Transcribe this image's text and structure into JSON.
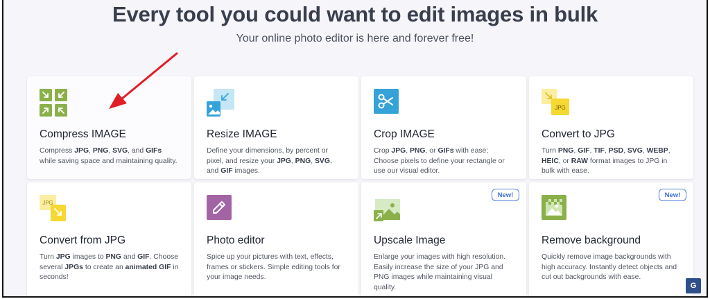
{
  "header": {
    "title": "Every tool you could want to edit images in bulk",
    "subtitle": "Your online photo editor is here and forever free!"
  },
  "cards": [
    {
      "title": "Compress IMAGE",
      "icon": "compress-icon",
      "desc": [
        [
          "Compress ",
          false
        ],
        [
          "JPG",
          true
        ],
        [
          ", ",
          false
        ],
        [
          "PNG",
          true
        ],
        [
          ", ",
          false
        ],
        [
          "SVG",
          true
        ],
        [
          ", and ",
          false
        ],
        [
          "GIFs",
          true
        ],
        [
          " while saving space and maintaining quality.",
          false
        ]
      ]
    },
    {
      "title": "Resize IMAGE",
      "icon": "resize-icon",
      "desc": [
        [
          "Define your dimensions, by percent or pixel, and resize your ",
          false
        ],
        [
          "JPG",
          true
        ],
        [
          ", ",
          false
        ],
        [
          "PNG",
          true
        ],
        [
          ", ",
          false
        ],
        [
          "SVG",
          true
        ],
        [
          ", and ",
          false
        ],
        [
          "GIF",
          true
        ],
        [
          " images.",
          false
        ]
      ]
    },
    {
      "title": "Crop IMAGE",
      "icon": "scissors-icon",
      "desc": [
        [
          "Crop ",
          false
        ],
        [
          "JPG",
          true
        ],
        [
          ", ",
          false
        ],
        [
          "PNG",
          true
        ],
        [
          ", or ",
          false
        ],
        [
          "GIFs",
          true
        ],
        [
          " with ease; Choose pixels to define your rectangle or use our visual editor.",
          false
        ]
      ]
    },
    {
      "title": "Convert to JPG",
      "icon": "convert-to-jpg-icon",
      "desc": [
        [
          "Turn ",
          false
        ],
        [
          "PNG",
          true
        ],
        [
          ", ",
          false
        ],
        [
          "GIF",
          true
        ],
        [
          ", ",
          false
        ],
        [
          "TIF",
          true
        ],
        [
          ", ",
          false
        ],
        [
          "PSD",
          true
        ],
        [
          ", ",
          false
        ],
        [
          "SVG",
          true
        ],
        [
          ", ",
          false
        ],
        [
          "WEBP",
          true
        ],
        [
          ", ",
          false
        ],
        [
          "HEIC",
          true
        ],
        [
          ", or ",
          false
        ],
        [
          "RAW",
          true
        ],
        [
          " format images to JPG in bulk with ease.",
          false
        ]
      ]
    },
    {
      "title": "Convert from JPG",
      "icon": "convert-from-jpg-icon",
      "desc": [
        [
          "Turn ",
          false
        ],
        [
          "JPG",
          true
        ],
        [
          " images to ",
          false
        ],
        [
          "PNG",
          true
        ],
        [
          " and ",
          false
        ],
        [
          "GIF",
          true
        ],
        [
          ". Choose several ",
          false
        ],
        [
          "JPGs",
          true
        ],
        [
          " to create an ",
          false
        ],
        [
          "animated GIF",
          true
        ],
        [
          " in seconds!",
          false
        ]
      ]
    },
    {
      "title": "Photo editor",
      "icon": "pencil-icon",
      "desc": [
        [
          "Spice up your pictures with text, effects, frames or stickers. Simple editing tools for your image needs.",
          false
        ]
      ]
    },
    {
      "title": "Upscale Image",
      "icon": "upscale-icon",
      "badge": "New!",
      "desc": [
        [
          "Enlarge your images with high resolution. Easily increase the size of your JPG and PNG images while maintaining visual quality.",
          false
        ]
      ]
    },
    {
      "title": "Remove background",
      "icon": "remove-background-icon",
      "badge": "New!",
      "desc": [
        [
          "Quickly remove image backgrounds with high accuracy. Instantly detect objects and cut out backgrounds with ease.",
          false
        ]
      ]
    }
  ],
  "icons": {
    "green": "#8bb04a",
    "blue": "#35a3d8",
    "yellow": "#f6d832",
    "purple": "#a364a6",
    "accent_red": "#e11d27"
  }
}
